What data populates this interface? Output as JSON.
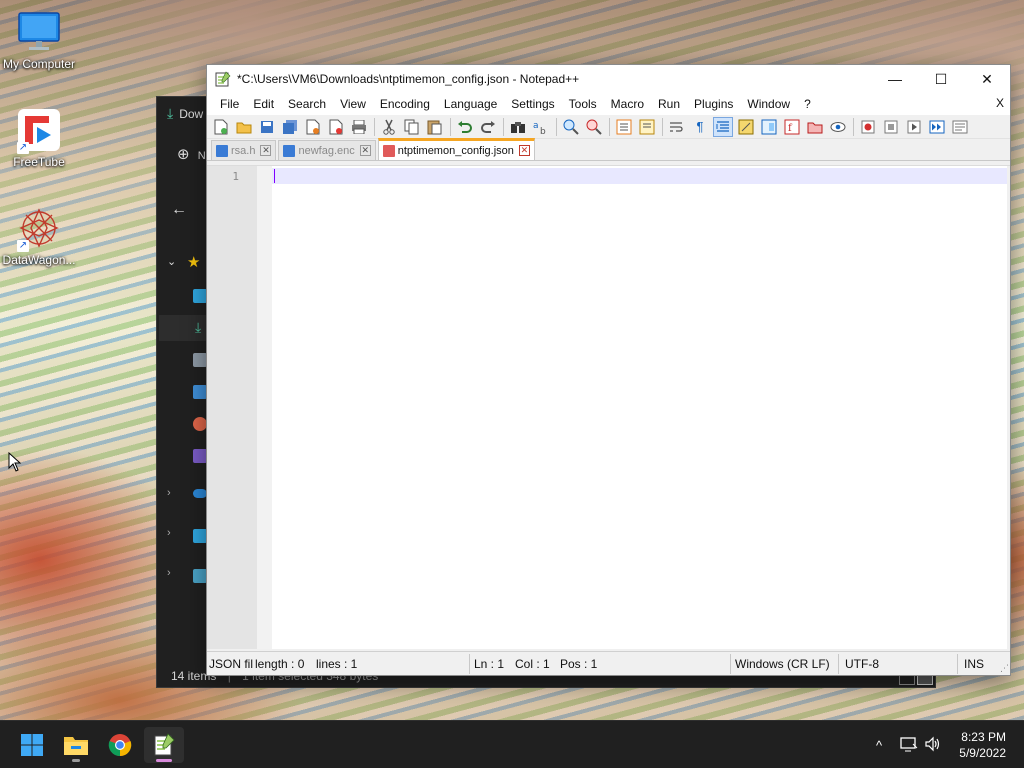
{
  "desktop": {
    "icons": [
      {
        "label": "My Computer"
      },
      {
        "label": "FreeTube"
      },
      {
        "label": "DataWagon..."
      }
    ]
  },
  "explorer": {
    "title_fragment": "Dow",
    "new_fragment": "N",
    "status": {
      "items": "14 items",
      "separator": "|",
      "selection": "1 item selected  348 bytes"
    }
  },
  "notepadpp": {
    "title": "*C:\\Users\\VM6\\Downloads\\ntptimemon_config.json - Notepad++",
    "window_buttons": {
      "minimize": "—",
      "maximize": "☐",
      "close": "✕"
    },
    "menu": [
      "File",
      "Edit",
      "Search",
      "View",
      "Encoding",
      "Language",
      "Settings",
      "Tools",
      "Macro",
      "Run",
      "Plugins",
      "Window",
      "?"
    ],
    "menu_close": "X",
    "tabs": [
      {
        "label": "rsa.h",
        "active": false,
        "color": "#3a7bd5"
      },
      {
        "label": "newfag.enc",
        "active": false,
        "color": "#3a7bd5"
      },
      {
        "label": "ntptimemon_config.json",
        "active": true,
        "color": "#e05a5a"
      }
    ],
    "tab_close_glyph": "✕",
    "editor": {
      "line_numbers": [
        "1"
      ],
      "content": ""
    },
    "statusbar": {
      "filetype": "JSON fil",
      "length": "length : 0",
      "lines": "lines : 1",
      "ln": "Ln : 1",
      "col": "Col : 1",
      "pos": "Pos : 1",
      "eol": "Windows (CR LF)",
      "encoding": "UTF-8",
      "mode": "INS"
    }
  },
  "taskbar": {
    "clock": {
      "time": "8:23 PM",
      "date": "5/9/2022"
    },
    "tray_chevron": "^"
  },
  "colors": {
    "accent_tab": "#f5a623",
    "caret": "#8000ff",
    "current_line": "#e8e8ff"
  }
}
